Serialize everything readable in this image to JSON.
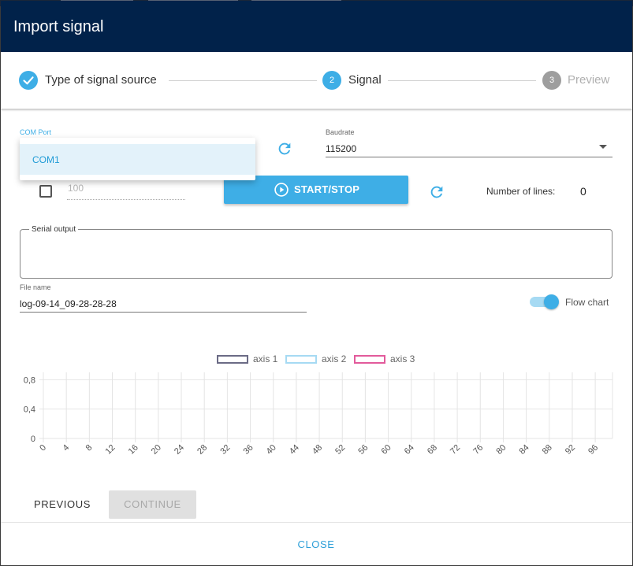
{
  "dialog": {
    "title": "Import signal"
  },
  "stepper": {
    "steps": [
      {
        "number": "1",
        "label": "Type of signal source",
        "state": "completed"
      },
      {
        "number": "2",
        "label": "Signal",
        "state": "active"
      },
      {
        "number": "3",
        "label": "Preview",
        "state": "inactive"
      }
    ]
  },
  "com_port": {
    "label": "COM Port",
    "options": [
      "COM1"
    ]
  },
  "baudrate": {
    "label": "Baudrate",
    "value": "115200"
  },
  "line_limit": {
    "checked": false,
    "placeholder": "100"
  },
  "start_stop": {
    "label": "START/STOP"
  },
  "lines": {
    "label": "Number of lines:",
    "value": "0"
  },
  "serial_output": {
    "label": "Serial output",
    "value": ""
  },
  "file_name": {
    "label": "File name",
    "value": "log-09-14_09-28-28-28"
  },
  "flow_chart": {
    "label": "Flow chart",
    "enabled": true
  },
  "chart_data": {
    "type": "line",
    "series": [
      {
        "name": "axis 1",
        "color": "#6b6b85",
        "values": []
      },
      {
        "name": "axis 2",
        "color": "#a6daf3",
        "values": []
      },
      {
        "name": "axis 3",
        "color": "#e25a9b",
        "values": []
      }
    ],
    "x_ticks": [
      "0",
      "4",
      "8",
      "12",
      "16",
      "20",
      "24",
      "28",
      "32",
      "36",
      "40",
      "44",
      "48",
      "52",
      "56",
      "60",
      "64",
      "68",
      "72",
      "76",
      "80",
      "84",
      "88",
      "92",
      "96"
    ],
    "y_ticks": [
      "0",
      "0,4",
      "0,8"
    ],
    "ylim": [
      0,
      0.9
    ],
    "xlim": [
      0,
      99
    ],
    "grid": true,
    "legend_position": "top-center"
  },
  "actions": {
    "previous": "PREVIOUS",
    "continue": "CONTINUE",
    "close": "CLOSE"
  },
  "colors": {
    "header": "#01224a",
    "accent": "#3eaee6",
    "step_inactive": "#9e9e9e"
  }
}
